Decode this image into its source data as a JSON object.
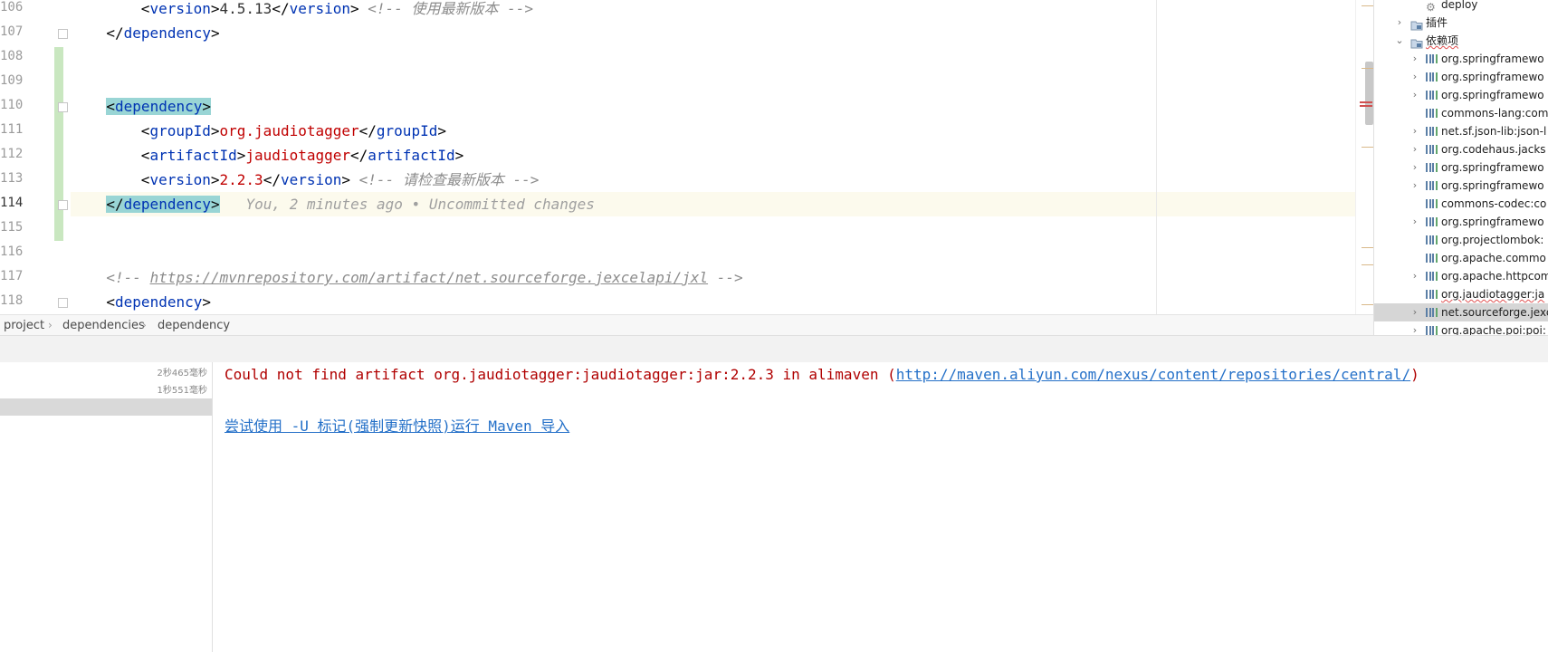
{
  "editor": {
    "lines": [
      {
        "num": "106",
        "indent": 2,
        "segments": [
          {
            "t": "<",
            "c": "br"
          },
          {
            "t": "version",
            "c": "tag"
          },
          {
            "t": ">",
            "c": "br"
          },
          {
            "t": "4.5.13",
            "c": "val-dark"
          },
          {
            "t": "</",
            "c": "br"
          },
          {
            "t": "version",
            "c": "tag"
          },
          {
            "t": ">",
            "c": "br"
          },
          {
            "t": " <!-- 使用最新版本 -->",
            "c": "cmt"
          }
        ]
      },
      {
        "num": "107",
        "indent": 1,
        "segments": [
          {
            "t": "</",
            "c": "br"
          },
          {
            "t": "dependency",
            "c": "tag"
          },
          {
            "t": ">",
            "c": "br"
          }
        ]
      },
      {
        "num": "108",
        "indent": 0,
        "segments": []
      },
      {
        "num": "109",
        "indent": 0,
        "segments": []
      },
      {
        "num": "110",
        "indent": 1,
        "segments": [
          {
            "t": "<",
            "c": "br hl"
          },
          {
            "t": "dependency",
            "c": "tag hl"
          },
          {
            "t": ">",
            "c": "br hl"
          }
        ]
      },
      {
        "num": "111",
        "indent": 2,
        "segments": [
          {
            "t": "<",
            "c": "br"
          },
          {
            "t": "groupId",
            "c": "tag"
          },
          {
            "t": ">",
            "c": "br"
          },
          {
            "t": "org.jaudiotagger",
            "c": "val"
          },
          {
            "t": "</",
            "c": "br"
          },
          {
            "t": "groupId",
            "c": "tag"
          },
          {
            "t": ">",
            "c": "br"
          }
        ]
      },
      {
        "num": "112",
        "indent": 2,
        "segments": [
          {
            "t": "<",
            "c": "br"
          },
          {
            "t": "artifactId",
            "c": "tag"
          },
          {
            "t": ">",
            "c": "br"
          },
          {
            "t": "jaudiotagger",
            "c": "val"
          },
          {
            "t": "</",
            "c": "br"
          },
          {
            "t": "artifactId",
            "c": "tag"
          },
          {
            "t": ">",
            "c": "br"
          }
        ]
      },
      {
        "num": "113",
        "indent": 2,
        "segments": [
          {
            "t": "<",
            "c": "br"
          },
          {
            "t": "version",
            "c": "tag"
          },
          {
            "t": ">",
            "c": "br"
          },
          {
            "t": "2.2.3",
            "c": "val"
          },
          {
            "t": "</",
            "c": "br"
          },
          {
            "t": "version",
            "c": "tag"
          },
          {
            "t": ">",
            "c": "br"
          },
          {
            "t": " <!-- 请检查最新版本 -->",
            "c": "cmt"
          }
        ]
      },
      {
        "num": "114",
        "indent": 1,
        "current": true,
        "segments": [
          {
            "t": "</",
            "c": "br hl"
          },
          {
            "t": "dependency",
            "c": "tag hl"
          },
          {
            "t": ">",
            "c": "br hl"
          },
          {
            "t": "   You, 2 minutes ago • Uncommitted changes",
            "c": "blame"
          }
        ]
      },
      {
        "num": "115",
        "indent": 0,
        "segments": []
      },
      {
        "num": "116",
        "indent": 0,
        "segments": []
      },
      {
        "num": "117",
        "indent": 1,
        "segments": [
          {
            "t": "<!-- ",
            "c": "cmt"
          },
          {
            "t": "https://mvnrepository.com/artifact/net.sourceforge.jexcelapi/jxl",
            "c": "cmt-link"
          },
          {
            "t": " -->",
            "c": "cmt"
          }
        ]
      },
      {
        "num": "118",
        "indent": 1,
        "segments": [
          {
            "t": "<",
            "c": "br"
          },
          {
            "t": "dependency",
            "c": "tag"
          },
          {
            "t": ">",
            "c": "br"
          }
        ]
      }
    ]
  },
  "breadcrumb": [
    "project",
    "dependencies",
    "dependency"
  ],
  "maven_tree": {
    "items": [
      {
        "label": "deploy",
        "level": 3,
        "chevron": "",
        "icon": "gear-icon"
      },
      {
        "label": "插件",
        "level": 2,
        "chevron": "›",
        "icon": "plugins-folder-icon"
      },
      {
        "label": "依赖项",
        "level": 2,
        "chevron": "⌄",
        "icon": "dependencies-folder-icon",
        "squiggle": true
      },
      {
        "label": "org.springframewo",
        "level": 3,
        "chevron": "›",
        "icon": "library-icon"
      },
      {
        "label": "org.springframewo",
        "level": 3,
        "chevron": "›",
        "icon": "library-icon"
      },
      {
        "label": "org.springframewo",
        "level": 3,
        "chevron": "›",
        "icon": "library-icon"
      },
      {
        "label": "commons-lang:com",
        "level": 3,
        "chevron": "",
        "icon": "library-icon"
      },
      {
        "label": "net.sf.json-lib:json-l",
        "level": 3,
        "chevron": "›",
        "icon": "library-icon"
      },
      {
        "label": "org.codehaus.jacks",
        "level": 3,
        "chevron": "›",
        "icon": "library-icon"
      },
      {
        "label": "org.springframewo",
        "level": 3,
        "chevron": "›",
        "icon": "library-icon"
      },
      {
        "label": "org.springframewo",
        "level": 3,
        "chevron": "›",
        "icon": "library-icon"
      },
      {
        "label": "commons-codec:co",
        "level": 3,
        "chevron": "",
        "icon": "library-icon"
      },
      {
        "label": "org.springframewo",
        "level": 3,
        "chevron": "›",
        "icon": "library-icon"
      },
      {
        "label": "org.projectlombok:",
        "level": 3,
        "chevron": "",
        "icon": "library-icon"
      },
      {
        "label": "org.apache.commo",
        "level": 3,
        "chevron": "",
        "icon": "library-icon"
      },
      {
        "label": "org.apache.httpcom",
        "level": 3,
        "chevron": "›",
        "icon": "library-icon"
      },
      {
        "label": "org.jaudiotagger:ja",
        "level": 3,
        "chevron": "",
        "icon": "library-icon",
        "squiggle": true
      },
      {
        "label": "net.sourceforge.jexc",
        "level": 3,
        "chevron": "›",
        "icon": "library-icon",
        "selected": true
      },
      {
        "label": "org.apache.poi:poi:",
        "level": 3,
        "chevron": "›",
        "icon": "library-icon"
      }
    ]
  },
  "build": {
    "timings": [
      "2秒465毫秒",
      "1秒551毫秒"
    ],
    "error_prefix": "Could not find artifact org.jaudiotagger:jaudiotagger:jar:2.2.3 in alimaven (",
    "error_link": "http://maven.aliyun.com/nexus/content/repositories/central/",
    "error_suffix": ")",
    "maven_hint": "尝试使用 -U 标记(强制更新快照)运行 Maven 导入"
  }
}
